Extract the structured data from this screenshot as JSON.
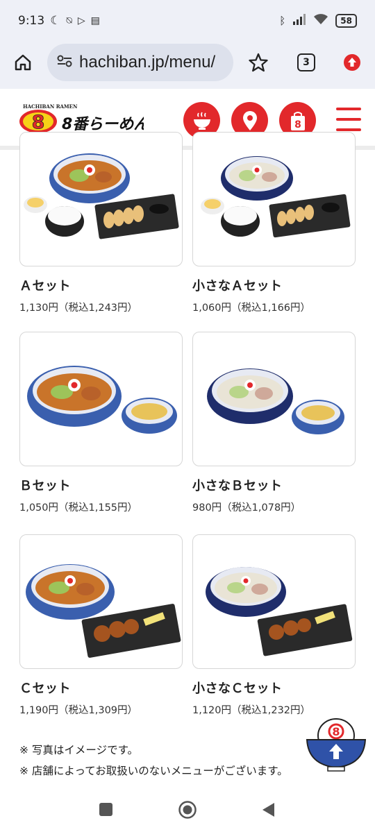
{
  "status": {
    "time": "9:13",
    "battery": "58"
  },
  "browser": {
    "url": "hachiban.jp/menu/",
    "tab_count": "3"
  },
  "site": {
    "logo_top": "HACHIBAN RAMEN",
    "logo_name": "8番らーめん",
    "logo_mark": "8",
    "bag_mark": "8"
  },
  "items": [
    {
      "name": "Ａセット",
      "price": "1,130円（税込1,243円）"
    },
    {
      "name": "小さなＡセット",
      "price": "1,060円（税込1,166円）"
    },
    {
      "name": "Ｂセット",
      "price": "1,050円（税込1,155円）"
    },
    {
      "name": "小さなＢセット",
      "price": "980円（税込1,078円）"
    },
    {
      "name": "Ｃセット",
      "price": "1,190円（税込1,309円）"
    },
    {
      "name": "小さなＣセット",
      "price": "1,120円（税込1,232円）"
    }
  ],
  "notes": [
    "※ 写真はイメージです。",
    "※ 店舗によってお取扱いのないメニューがございます。"
  ],
  "scroll_top_mark": "8",
  "colors": {
    "brand_red": "#e2282b",
    "brand_yellow": "#f7d117",
    "chrome_bg": "#eef0f7"
  },
  "icons": {
    "home": "home-icon",
    "site_info": "tune-icon",
    "bookmark": "star-icon",
    "update": "arrow-up-circle-icon",
    "menu_bowl": "ramen-bowl-icon",
    "location": "location-pin-icon",
    "takeout": "takeout-bag-icon",
    "hamburger": "hamburger-menu-icon"
  }
}
